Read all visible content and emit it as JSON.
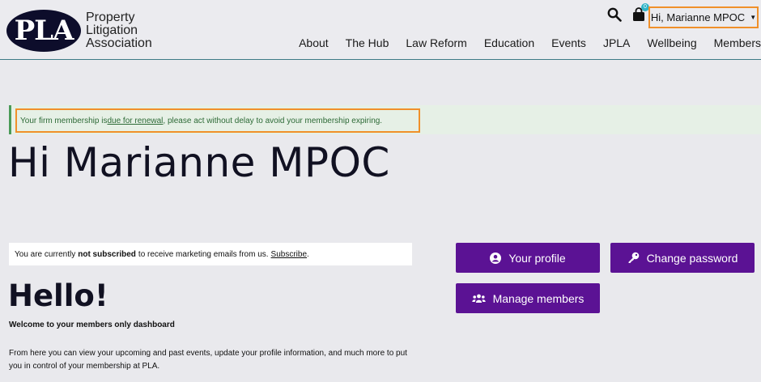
{
  "brand": {
    "logo_letters": "PLA",
    "name_lines": [
      "Property",
      "Litigation",
      "Association"
    ]
  },
  "nav": {
    "items": [
      "About",
      "The Hub",
      "Law Reform",
      "Education",
      "Events",
      "JPLA",
      "Wellbeing",
      "Members"
    ]
  },
  "cart": {
    "count": "0"
  },
  "user_menu": {
    "label": "Hi, Marianne MPOC"
  },
  "notice": {
    "before": "Your firm membership is ",
    "link": "due for renewal",
    "after": ", please act without delay to avoid your membership expiring."
  },
  "greeting": "Hi Marianne MPOC",
  "subscribe": {
    "before": "You are currently",
    "bold": "not subscribed",
    "after": "to receive marketing emails from us.",
    "link": "Subscribe",
    "end": "."
  },
  "dashboard": {
    "heading": "Hello!",
    "welcome": "Welcome to your members only dashboard",
    "intro": "From here you can view your upcoming and past events, update your profile information, and much more to put you in control of your membership at PLA."
  },
  "buttons": {
    "profile": "Your profile",
    "password": "Change password",
    "members": "Manage members"
  },
  "colors": {
    "primary": "#5b1294",
    "highlight": "#f0902a",
    "notice_text": "#2d6a36",
    "badge": "#2fb4c8"
  }
}
